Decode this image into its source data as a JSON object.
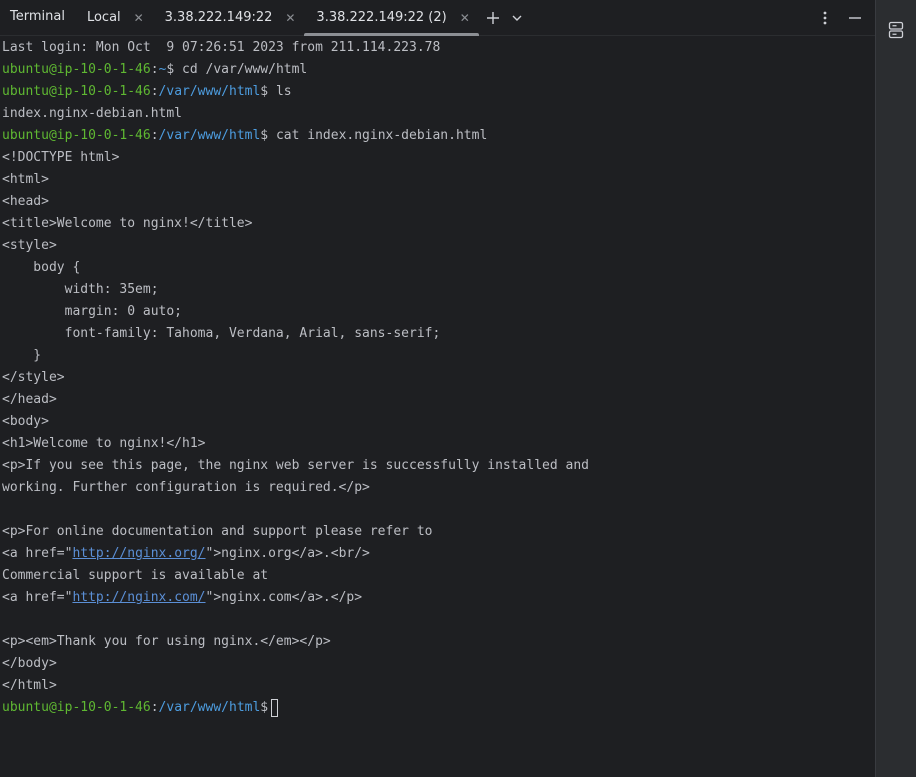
{
  "tool_window": {
    "title": "Terminal"
  },
  "tabs": [
    {
      "label": "Local"
    },
    {
      "label": "3.38.222.149:22"
    },
    {
      "label": "3.38.222.149:22 (2)"
    }
  ],
  "icons": {
    "add": "plus-icon",
    "dropdown": "chevron-down-icon",
    "more": "more-vertical-icon",
    "minimize": "minimize-icon",
    "server": "server-icon",
    "close": "close-icon"
  },
  "colors": {
    "background": "#1e1f22",
    "prompt_user": "#5fb832",
    "prompt_path": "#4d9de0",
    "text": "#bcbec4"
  },
  "terminal": {
    "login": "Last login: Mon Oct  9 07:26:51 2023 from 211.114.223.78",
    "prompt_user": "ubuntu@ip-10-0-1-46",
    "home_path": "~",
    "www_path": "/var/www/html",
    "dollar": "$",
    "cmd1": " cd /var/www/html",
    "cmd2": " ls",
    "ls_output": "index.nginx-debian.html",
    "cmd3": " cat index.nginx-debian.html",
    "html_lines": [
      "<!DOCTYPE html>",
      "<html>",
      "<head>",
      "<title>Welcome to nginx!</title>",
      "<style>",
      "    body {",
      "        width: 35em;",
      "        margin: 0 auto;",
      "        font-family: Tahoma, Verdana, Arial, sans-serif;",
      "    }",
      "</style>",
      "</head>",
      "<body>",
      "<h1>Welcome to nginx!</h1>",
      "<p>If you see this page, the nginx web server is successfully installed and",
      "working. Further configuration is required.</p>",
      "",
      "<p>For online documentation and support please refer to"
    ],
    "link1_prefix": "<a href=\"",
    "link1_url": "http://nginx.org/",
    "link1_suffix": "\">nginx.org</a>.<br/>",
    "commercial": "Commercial support is available at",
    "link2_prefix": "<a href=\"",
    "link2_url": "http://nginx.com/",
    "link2_suffix": "\">nginx.com</a>.</p>",
    "tail_lines": [
      "",
      "<p><em>Thank you for using nginx.</em></p>",
      "</body>",
      "</html>"
    ]
  }
}
